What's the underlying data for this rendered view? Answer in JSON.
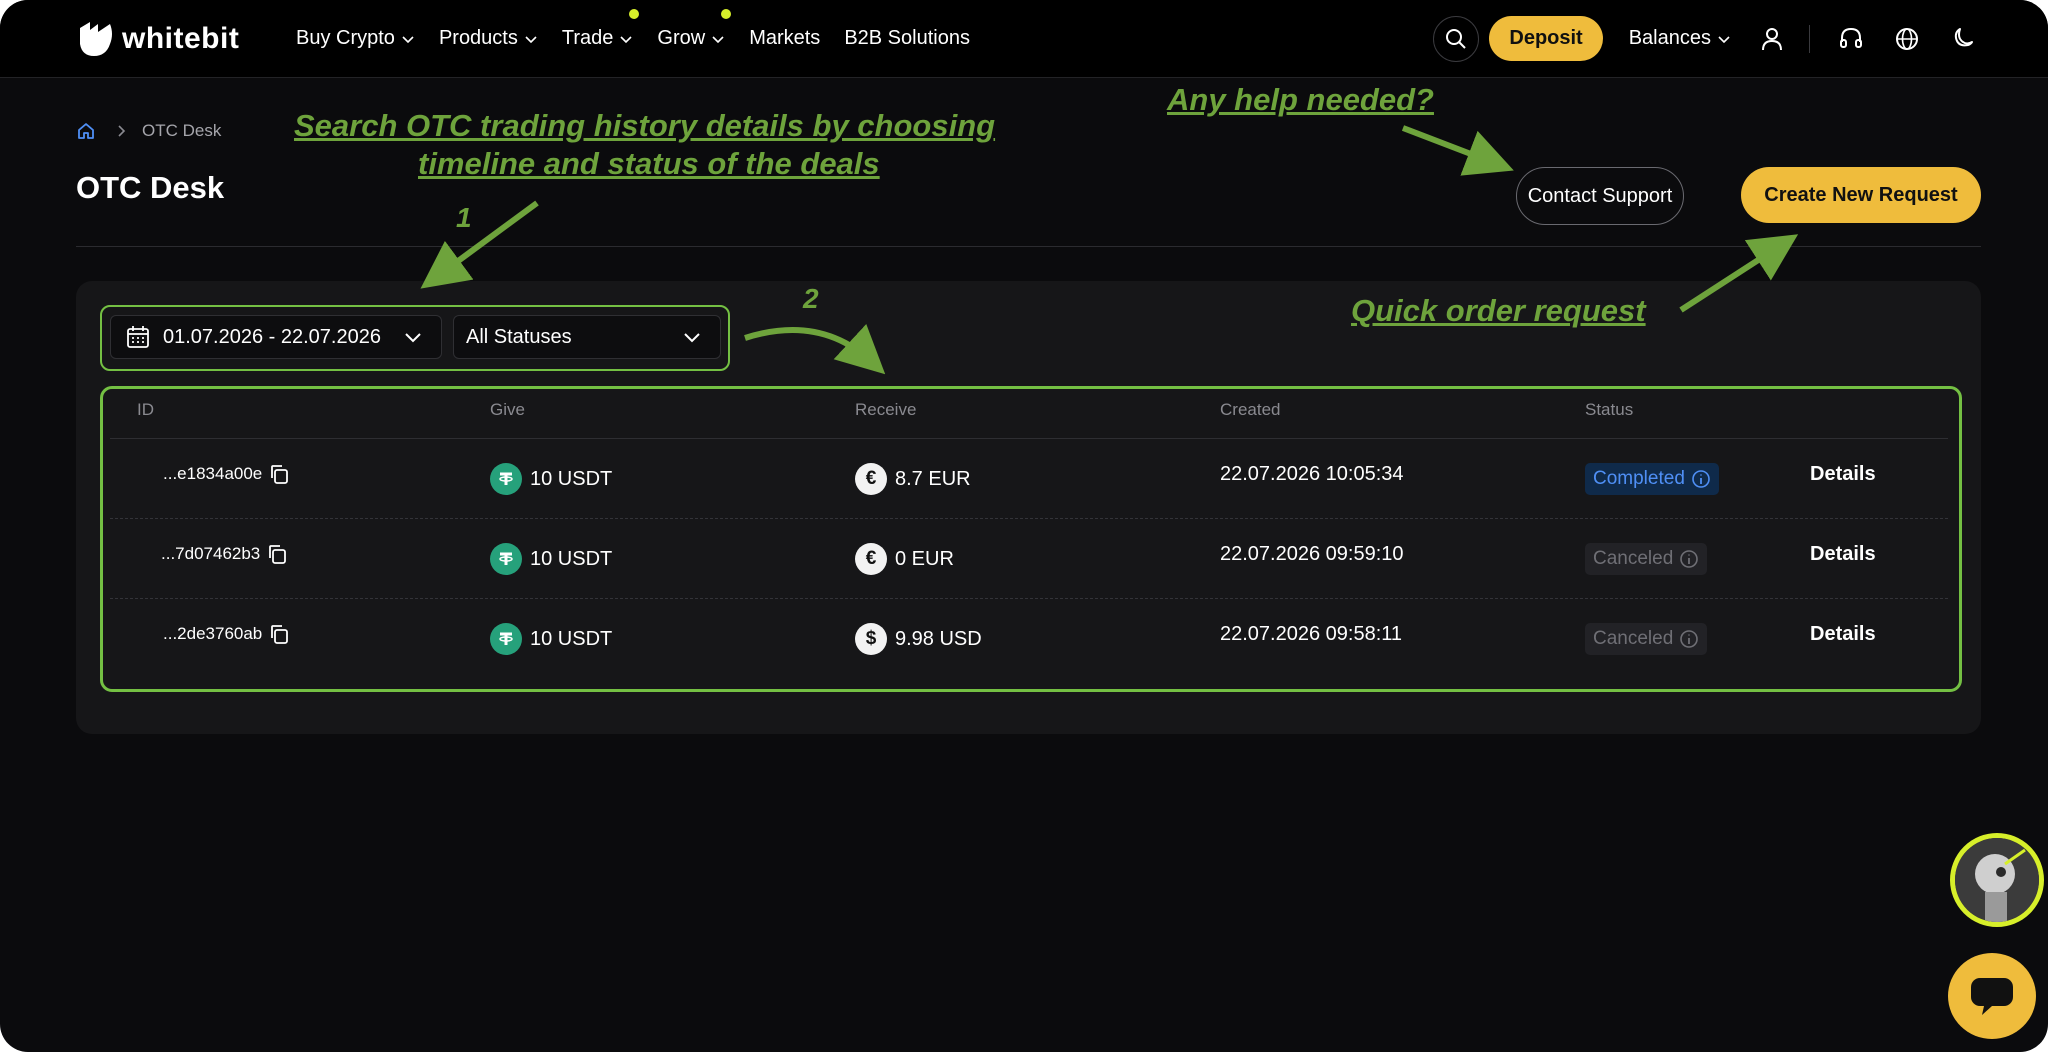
{
  "header": {
    "logo": "whitebit",
    "nav": [
      {
        "label": "Buy Crypto",
        "has_chevron": true,
        "dot": false
      },
      {
        "label": "Products",
        "has_chevron": true,
        "dot": false
      },
      {
        "label": "Trade",
        "has_chevron": true,
        "dot": true
      },
      {
        "label": "Grow",
        "has_chevron": true,
        "dot": true
      },
      {
        "label": "Markets",
        "has_chevron": false,
        "dot": false
      },
      {
        "label": "B2B Solutions",
        "has_chevron": false,
        "dot": false
      }
    ],
    "deposit_label": "Deposit",
    "balances_label": "Balances"
  },
  "breadcrumb": {
    "current": "OTC Desk"
  },
  "page": {
    "title": "OTC Desk",
    "contact_support": "Contact Support",
    "create_request": "Create New Request"
  },
  "filters": {
    "date_range": "01.07.2026 - 22.07.2026",
    "status": "All Statuses"
  },
  "table": {
    "headers": [
      "ID",
      "Give",
      "Receive",
      "Created",
      "Status"
    ],
    "rows": [
      {
        "id": "...e1834a00e",
        "give": "10 USDT",
        "receive": "8.7 EUR",
        "receive_coin": "eur",
        "created": "22.07.2026 10:05:34",
        "status": "Completed",
        "action": "Details"
      },
      {
        "id": "...7d07462b3",
        "give": "10 USDT",
        "receive": "0 EUR",
        "receive_coin": "eur",
        "created": "22.07.2026 09:59:10",
        "status": "Canceled",
        "action": "Details"
      },
      {
        "id": "...2de3760ab",
        "give": "10 USDT",
        "receive": "9.98 USD",
        "receive_coin": "usd",
        "created": "22.07.2026 09:58:11",
        "status": "Canceled",
        "action": "Details"
      }
    ]
  },
  "annotations": {
    "search_line1": "Search OTC trading history details by choosing",
    "search_line2": "timeline and status of the deals",
    "help": "Any help needed?",
    "quick": "Quick order request",
    "num1": "1",
    "num2": "2"
  },
  "colors": {
    "accent_yellow": "#efbc3c",
    "annotation_green": "#6ea33c",
    "highlight_green": "#74c043",
    "completed_blue": "#4f8ff5"
  }
}
